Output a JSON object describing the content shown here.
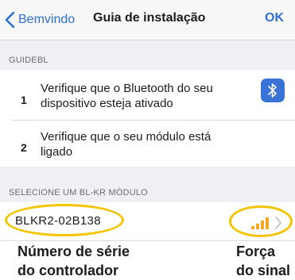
{
  "navbar": {
    "back_label": "Bemvindo",
    "title": "Guia de instalação",
    "ok_label": "OK"
  },
  "guide_section": {
    "header": "GUIDEBL",
    "steps": [
      {
        "number": "1",
        "text": "Verifique que o Bluetooth do seu dispositivo esteja ativado"
      },
      {
        "number": "2",
        "text": "Verifique que o seu módulo está ligado"
      }
    ]
  },
  "module_section": {
    "header": "SELECIONE UM BL-KR MÓDULO",
    "device_name": "BLKR2-02B138",
    "signal_bars": 4
  },
  "annotations": {
    "serial_caption_line1": "Número de série",
    "serial_caption_line2": "do controlador",
    "signal_caption_line1": "Força",
    "signal_caption_line2": "do sinal"
  },
  "colors": {
    "accent": "#2f6fd4",
    "bluetooth_tile": "#3a73d6",
    "signal": "#f5a623",
    "highlight": "#f5c400"
  },
  "icons": [
    "chevron-left-icon",
    "bluetooth-icon",
    "signal-strength-icon",
    "chevron-right-icon"
  ]
}
